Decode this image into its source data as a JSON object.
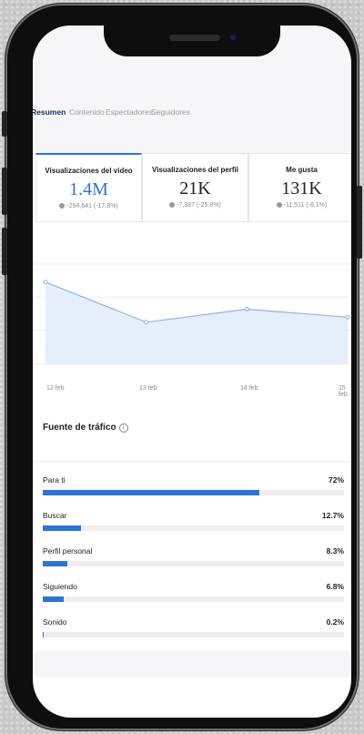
{
  "tabs": [
    "Resumen",
    "Contenido",
    "Espectadores",
    "Seguidores"
  ],
  "stats": [
    {
      "label": "Visualizaciones del video",
      "value": "1.4M",
      "change": "-294,641 (-17.8%)"
    },
    {
      "label": "Visualizaciones del perfil",
      "value": "21K",
      "change": "-7,387 (-25.8%)"
    },
    {
      "label": "Me gusta",
      "value": "131K",
      "change": "-11,511 (-8.1%)"
    }
  ],
  "chart_data": {
    "type": "area",
    "x": [
      "12 feb",
      "13 feb",
      "14 feb",
      "15 feb"
    ],
    "values": [
      0.82,
      0.42,
      0.55,
      0.47
    ],
    "y_scale_note": "relative",
    "grid": true,
    "color": "#8fb4e6"
  },
  "traffic": {
    "title": "Fuente de tráfico",
    "sources": [
      {
        "label": "Para ti",
        "value": "72%",
        "pct": 72
      },
      {
        "label": "Buscar",
        "value": "12.7%",
        "pct": 12.7
      },
      {
        "label": "Perfil personal",
        "value": "8.3%",
        "pct": 8.3
      },
      {
        "label": "Siguiendo",
        "value": "6.8%",
        "pct": 6.8
      },
      {
        "label": "Sonido",
        "value": "0.2%",
        "pct": 0.2
      }
    ]
  },
  "colors": {
    "accent": "#2d74d6",
    "text": "#222222",
    "muted": "#8a8a8a"
  }
}
